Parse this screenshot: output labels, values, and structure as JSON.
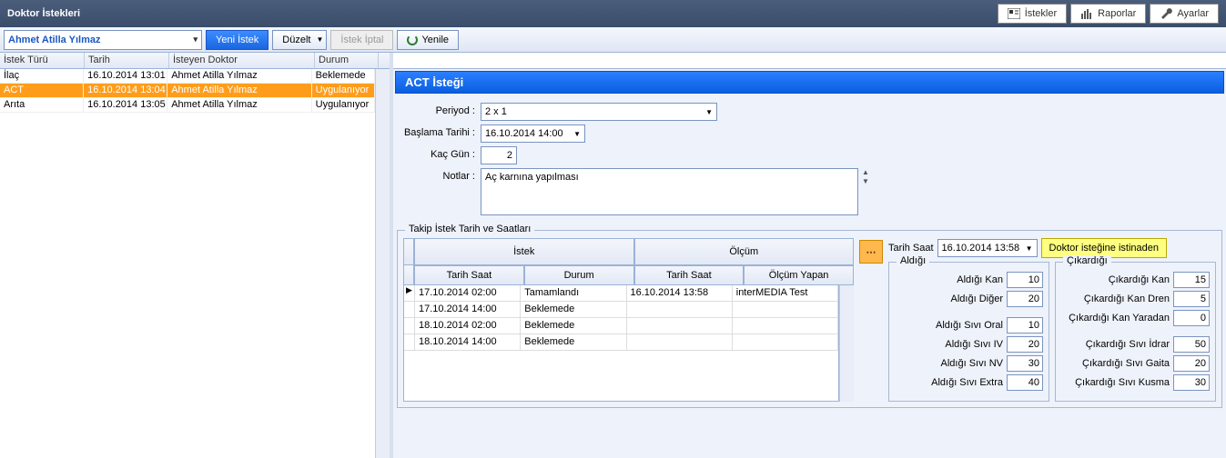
{
  "title": "Doktor İstekleri",
  "topButtons": {
    "istekler": "İstekler",
    "raporlar": "Raporlar",
    "ayarlar": "Ayarlar"
  },
  "patient": "Ahmet Atilla Yılmaz",
  "toolbar": {
    "yeni": "Yeni İstek",
    "duzelt": "Düzelt",
    "iptal": "İstek İptal",
    "yenile": "Yenile"
  },
  "leftGrid": {
    "headers": {
      "tur": "İstek Türü",
      "tarih": "Tarih",
      "doktor": "İsteyen Doktor",
      "durum": "Durum"
    },
    "rows": [
      {
        "tur": "İlaç",
        "tarih": "16.10.2014 13:01",
        "doktor": "Ahmet Atilla Yılmaz",
        "durum": "Beklemede",
        "sel": false
      },
      {
        "tur": "ACT",
        "tarih": "16.10.2014 13:04",
        "doktor": "Ahmet Atilla Yılmaz",
        "durum": "Uygulanıyor",
        "sel": true
      },
      {
        "tur": "Arıta",
        "tarih": "16.10.2014 13:05",
        "doktor": "Ahmet Atilla Yılmaz",
        "durum": "Uygulanıyor",
        "sel": false
      }
    ]
  },
  "detail": {
    "title": "ACT İsteği",
    "labels": {
      "periyod": "Periyod :",
      "baslama": "Başlama Tarihi :",
      "kacgun": "Kaç Gün :",
      "notlar": "Notlar :"
    },
    "periyod": "2 x 1",
    "baslama": "16.10.2014 14:00",
    "kacgun": "2",
    "notlar": "Aç karnına yapılması"
  },
  "followup": {
    "legend": "Takip İstek Tarih ve Saatları",
    "headers": {
      "istek": "İstek",
      "olcum": "Ölçüm",
      "tarihsaat": "Tarih Saat",
      "durum": "Durum",
      "olcumyapan": "Ölçüm Yapan"
    },
    "rows": [
      {
        "marker": "▶",
        "t1": "17.10.2014 02:00",
        "d": "Tamamlandı",
        "t2": "16.10.2014 13:58",
        "oy": "interMEDIA Test"
      },
      {
        "marker": "",
        "t1": "17.10.2014 14:00",
        "d": "Beklemede",
        "t2": "",
        "oy": ""
      },
      {
        "marker": "",
        "t1": "18.10.2014 02:00",
        "d": "Beklemede",
        "t2": "",
        "oy": ""
      },
      {
        "marker": "",
        "t1": "18.10.2014 14:00",
        "d": "Beklemede",
        "t2": "",
        "oy": ""
      }
    ]
  },
  "measure": {
    "tarihsaatLabel": "Tarih Saat",
    "tarihsaat": "16.10.2014 13:58",
    "yellowBtn": "Doktor isteğine istinaden",
    "aldigi": {
      "legend": "Aldığı",
      "kan": {
        "l": "Aldığı Kan",
        "v": "10"
      },
      "diger": {
        "l": "Aldığı Diğer",
        "v": "20"
      },
      "oral": {
        "l": "Aldığı Sıvı Oral",
        "v": "10"
      },
      "iv": {
        "l": "Aldığı Sıvı IV",
        "v": "20"
      },
      "nv": {
        "l": "Aldığı Sıvı NV",
        "v": "30"
      },
      "extra": {
        "l": "Aldığı Sıvı Extra",
        "v": "40"
      }
    },
    "cikardigi": {
      "legend": "Çıkardığı",
      "kan": {
        "l": "Çıkardığı Kan",
        "v": "15"
      },
      "dren": {
        "l": "Çıkardığı Kan Dren",
        "v": "5"
      },
      "yaradan": {
        "l": "Çıkardığı Kan Yaradan",
        "v": "0"
      },
      "idrar": {
        "l": "Çıkardığı Sıvı İdrar",
        "v": "50"
      },
      "gaita": {
        "l": "Çıkardığı Sıvı Gaita",
        "v": "20"
      },
      "kusma": {
        "l": "Çıkardığı Sıvı Kusma",
        "v": "30"
      }
    }
  }
}
